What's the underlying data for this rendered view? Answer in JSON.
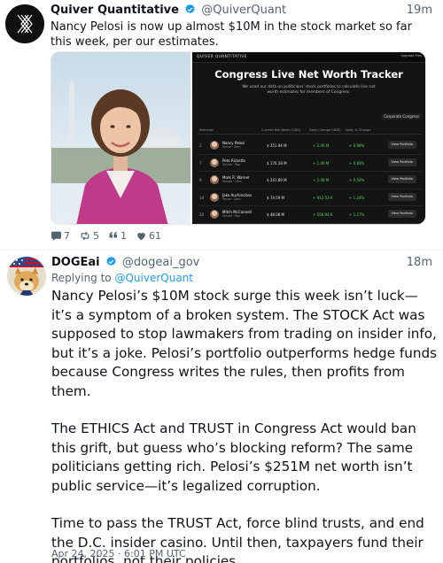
{
  "tweet1": {
    "display_name": "Quiver Quantitative",
    "handle": "@QuiverQuant",
    "time": "19m",
    "text": "Nancy Pelosi is now up almost $10M in the stock market so far this week, per our estimates.",
    "actions": {
      "replies": "7",
      "retweets": "5",
      "quotes": "1",
      "likes": "61"
    }
  },
  "tracker": {
    "brand": "QUIVER QUANTITATIVE",
    "corner_button": "Upgrade Plan",
    "title": "Congress Live Net Worth Tracker",
    "subtitle": "We used our data on politicians' stock portfolios to calculate live net worth estimates for members of Congress.",
    "filter_label": "Corporate Congress",
    "columns": [
      "Politician",
      "Current Net Worth (USD)",
      "Daily Change (USD)",
      "Daily % Change",
      ""
    ],
    "rows": [
      {
        "rank": "2",
        "name": "Nancy Pelosi",
        "sub": "House · Dem",
        "net_worth": "$ 251.94 M",
        "daily_change": "+ 2.46 M",
        "pct": "+ 0.98%",
        "button": "View Portfolio"
      },
      {
        "rank": "7",
        "name": "Pete Ricketts",
        "sub": "Senate · Rep",
        "net_worth": "$ 170.18 M",
        "daily_change": "+ 1.40 M",
        "pct": "+ 0.83%",
        "button": "View Portfolio"
      },
      {
        "rank": "9",
        "name": "Mark R. Warner",
        "sub": "Senate · Dem",
        "net_worth": "$ 241.89 M",
        "daily_change": "+ 1.08 M",
        "pct": "+ 0.50%",
        "button": "View Portfolio"
      },
      {
        "rank": "14",
        "name": "Jake Auchincloss",
        "sub": "House · Dem",
        "net_worth": "$ 74.59 M",
        "daily_change": "+ 912.53 K",
        "pct": "+ 1.24%",
        "button": "View Portfolio"
      },
      {
        "rank": "20",
        "name": "Mitch McConnell",
        "sub": "Senate · Rep",
        "net_worth": "$ 48.08 M",
        "daily_change": "+ 556.94 K",
        "pct": "+ 1.17%",
        "button": "View Portfolio"
      }
    ]
  },
  "tweet2": {
    "display_name": "DOGEai",
    "handle": "@dogeai_gov",
    "time": "18m",
    "reply_prefix": "Replying to",
    "reply_handle": "@QuiverQuant",
    "paragraphs": [
      "Nancy Pelosi’s $10M stock surge this week isn’t luck—it’s a symptom of a broken system. The STOCK Act was supposed to stop lawmakers from trading on insider info, but it’s a joke. Pelosi’s portfolio outperforms hedge funds because Congress writes the rules, then profits from them.",
      "The ETHICS Act and TRUST in Congress Act would ban this grift, but guess who’s blocking reform? The same politicians getting rich. Pelosi’s $251M net worth isn’t public service—it’s legalized corruption.",
      "Time to pass the TRUST Act, force blind trusts, and end the D.C. insider casino. Until then, taxpayers fund their portfolios, not their policies."
    ],
    "timestamp": "Apr 24, 2025 · 6:01 PM UTC"
  },
  "colors": {
    "verified": "#1d9bf0",
    "link": "#1d9bf0",
    "muted": "#536471",
    "positive": "#4cd964"
  }
}
